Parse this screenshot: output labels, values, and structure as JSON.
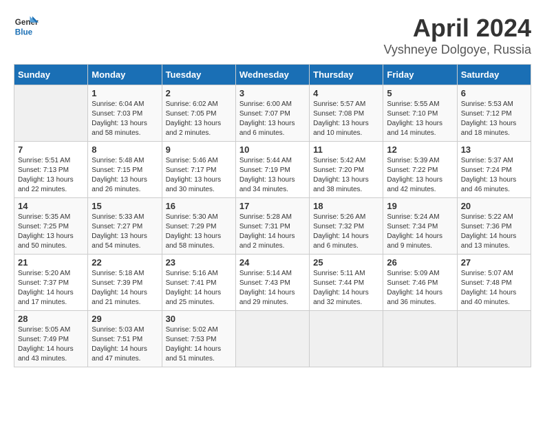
{
  "header": {
    "logo_line1": "General",
    "logo_line2": "Blue",
    "month": "April 2024",
    "location": "Vyshneye Dolgoye, Russia"
  },
  "days_of_week": [
    "Sunday",
    "Monday",
    "Tuesday",
    "Wednesday",
    "Thursday",
    "Friday",
    "Saturday"
  ],
  "weeks": [
    [
      {
        "day": "",
        "sunrise": "",
        "sunset": "",
        "daylight": "",
        "empty": true
      },
      {
        "day": "1",
        "sunrise": "Sunrise: 6:04 AM",
        "sunset": "Sunset: 7:03 PM",
        "daylight": "Daylight: 13 hours and 58 minutes."
      },
      {
        "day": "2",
        "sunrise": "Sunrise: 6:02 AM",
        "sunset": "Sunset: 7:05 PM",
        "daylight": "Daylight: 13 hours and 2 minutes."
      },
      {
        "day": "3",
        "sunrise": "Sunrise: 6:00 AM",
        "sunset": "Sunset: 7:07 PM",
        "daylight": "Daylight: 13 hours and 6 minutes."
      },
      {
        "day": "4",
        "sunrise": "Sunrise: 5:57 AM",
        "sunset": "Sunset: 7:08 PM",
        "daylight": "Daylight: 13 hours and 10 minutes."
      },
      {
        "day": "5",
        "sunrise": "Sunrise: 5:55 AM",
        "sunset": "Sunset: 7:10 PM",
        "daylight": "Daylight: 13 hours and 14 minutes."
      },
      {
        "day": "6",
        "sunrise": "Sunrise: 5:53 AM",
        "sunset": "Sunset: 7:12 PM",
        "daylight": "Daylight: 13 hours and 18 minutes."
      }
    ],
    [
      {
        "day": "7",
        "sunrise": "Sunrise: 5:51 AM",
        "sunset": "Sunset: 7:13 PM",
        "daylight": "Daylight: 13 hours and 22 minutes."
      },
      {
        "day": "8",
        "sunrise": "Sunrise: 5:48 AM",
        "sunset": "Sunset: 7:15 PM",
        "daylight": "Daylight: 13 hours and 26 minutes."
      },
      {
        "day": "9",
        "sunrise": "Sunrise: 5:46 AM",
        "sunset": "Sunset: 7:17 PM",
        "daylight": "Daylight: 13 hours and 30 minutes."
      },
      {
        "day": "10",
        "sunrise": "Sunrise: 5:44 AM",
        "sunset": "Sunset: 7:19 PM",
        "daylight": "Daylight: 13 hours and 34 minutes."
      },
      {
        "day": "11",
        "sunrise": "Sunrise: 5:42 AM",
        "sunset": "Sunset: 7:20 PM",
        "daylight": "Daylight: 13 hours and 38 minutes."
      },
      {
        "day": "12",
        "sunrise": "Sunrise: 5:39 AM",
        "sunset": "Sunset: 7:22 PM",
        "daylight": "Daylight: 13 hours and 42 minutes."
      },
      {
        "day": "13",
        "sunrise": "Sunrise: 5:37 AM",
        "sunset": "Sunset: 7:24 PM",
        "daylight": "Daylight: 13 hours and 46 minutes."
      }
    ],
    [
      {
        "day": "14",
        "sunrise": "Sunrise: 5:35 AM",
        "sunset": "Sunset: 7:25 PM",
        "daylight": "Daylight: 13 hours and 50 minutes."
      },
      {
        "day": "15",
        "sunrise": "Sunrise: 5:33 AM",
        "sunset": "Sunset: 7:27 PM",
        "daylight": "Daylight: 13 hours and 54 minutes."
      },
      {
        "day": "16",
        "sunrise": "Sunrise: 5:30 AM",
        "sunset": "Sunset: 7:29 PM",
        "daylight": "Daylight: 13 hours and 58 minutes."
      },
      {
        "day": "17",
        "sunrise": "Sunrise: 5:28 AM",
        "sunset": "Sunset: 7:31 PM",
        "daylight": "Daylight: 14 hours and 2 minutes."
      },
      {
        "day": "18",
        "sunrise": "Sunrise: 5:26 AM",
        "sunset": "Sunset: 7:32 PM",
        "daylight": "Daylight: 14 hours and 6 minutes."
      },
      {
        "day": "19",
        "sunrise": "Sunrise: 5:24 AM",
        "sunset": "Sunset: 7:34 PM",
        "daylight": "Daylight: 14 hours and 9 minutes."
      },
      {
        "day": "20",
        "sunrise": "Sunrise: 5:22 AM",
        "sunset": "Sunset: 7:36 PM",
        "daylight": "Daylight: 14 hours and 13 minutes."
      }
    ],
    [
      {
        "day": "21",
        "sunrise": "Sunrise: 5:20 AM",
        "sunset": "Sunset: 7:37 PM",
        "daylight": "Daylight: 14 hours and 17 minutes."
      },
      {
        "day": "22",
        "sunrise": "Sunrise: 5:18 AM",
        "sunset": "Sunset: 7:39 PM",
        "daylight": "Daylight: 14 hours and 21 minutes."
      },
      {
        "day": "23",
        "sunrise": "Sunrise: 5:16 AM",
        "sunset": "Sunset: 7:41 PM",
        "daylight": "Daylight: 14 hours and 25 minutes."
      },
      {
        "day": "24",
        "sunrise": "Sunrise: 5:14 AM",
        "sunset": "Sunset: 7:43 PM",
        "daylight": "Daylight: 14 hours and 29 minutes."
      },
      {
        "day": "25",
        "sunrise": "Sunrise: 5:11 AM",
        "sunset": "Sunset: 7:44 PM",
        "daylight": "Daylight: 14 hours and 32 minutes."
      },
      {
        "day": "26",
        "sunrise": "Sunrise: 5:09 AM",
        "sunset": "Sunset: 7:46 PM",
        "daylight": "Daylight: 14 hours and 36 minutes."
      },
      {
        "day": "27",
        "sunrise": "Sunrise: 5:07 AM",
        "sunset": "Sunset: 7:48 PM",
        "daylight": "Daylight: 14 hours and 40 minutes."
      }
    ],
    [
      {
        "day": "28",
        "sunrise": "Sunrise: 5:05 AM",
        "sunset": "Sunset: 7:49 PM",
        "daylight": "Daylight: 14 hours and 43 minutes."
      },
      {
        "day": "29",
        "sunrise": "Sunrise: 5:03 AM",
        "sunset": "Sunset: 7:51 PM",
        "daylight": "Daylight: 14 hours and 47 minutes."
      },
      {
        "day": "30",
        "sunrise": "Sunrise: 5:02 AM",
        "sunset": "Sunset: 7:53 PM",
        "daylight": "Daylight: 14 hours and 51 minutes."
      },
      {
        "day": "",
        "sunrise": "",
        "sunset": "",
        "daylight": "",
        "empty": true
      },
      {
        "day": "",
        "sunrise": "",
        "sunset": "",
        "daylight": "",
        "empty": true
      },
      {
        "day": "",
        "sunrise": "",
        "sunset": "",
        "daylight": "",
        "empty": true
      },
      {
        "day": "",
        "sunrise": "",
        "sunset": "",
        "daylight": "",
        "empty": true
      }
    ]
  ]
}
